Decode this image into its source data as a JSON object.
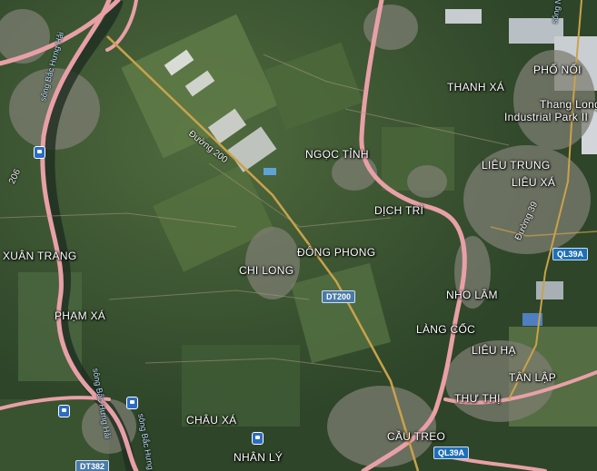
{
  "map": {
    "colors": {
      "main_road": "#e8a0a6",
      "provincial_road": "#c9a24a",
      "field_dark": "#2f4a2c",
      "field_light": "#5d7a4a",
      "urban": "#8b8a80"
    },
    "places": {
      "pho_noi": "PHỐ NỐI",
      "thanh_xa": "THANH XÁ",
      "thang_long_1": "Thang Long",
      "thang_long_2": "Industrial Park II",
      "ngoc_tinh": "NGỌC TỈNH",
      "lieu_trung": "LIÊU TRUNG",
      "lieu_xa": "LIÊU XÁ",
      "dich_tri": "DỊCH TRÌ",
      "xuan_trang": "XUÂN TRANG",
      "dong_phong": "ĐÔNG PHONG",
      "chi_long": "CHI LONG",
      "nho_lam": "NHO LÂM",
      "pham_xa": "PHẠM XÁ",
      "lang_coc": "LÀNG CỐC",
      "lieu_ha": "LIÊU HẠ",
      "tan_lap": "TÂN LẬP",
      "thu_thi": "THƯ THỊ",
      "chau_xa": "CHÂU XÁ",
      "cau_treo": "CẦU TREO",
      "nhan_ly": "NHÂN LÝ"
    },
    "road_labels": {
      "duong_200": "Đường 200",
      "duong_39": "Đường 39",
      "r206": "206"
    },
    "river_labels": {
      "song_bac_hung_hai_1": "sông Bắc Hưng Hải",
      "song_bac_hung_hai_2": "sông Bắc Hưng Hải",
      "song_bac_hung_hai_3": "sông Bắc Hưng Hải",
      "song_nha": "sông Nhà"
    },
    "shields": {
      "dt200": "DT200",
      "ql39a_1": "QL39A",
      "ql39a_2": "QL39A",
      "dt382": "DT382"
    },
    "icons": [
      "bus-stop-icon",
      "bus-stop-icon",
      "bus-stop-icon",
      "bus-stop-icon"
    ]
  }
}
